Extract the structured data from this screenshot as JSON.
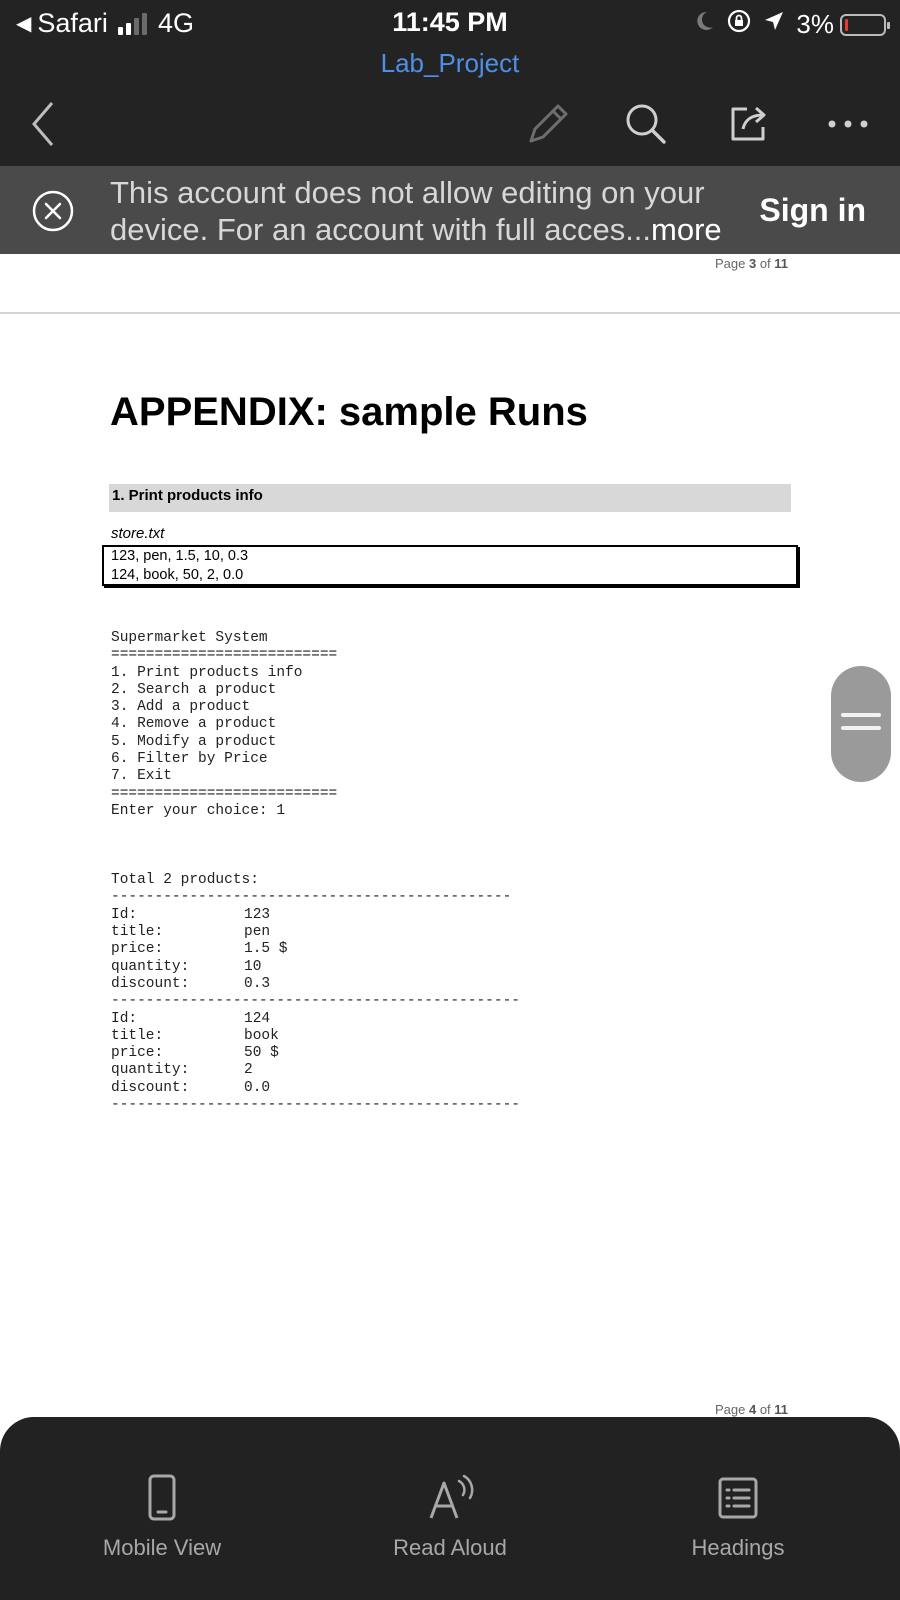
{
  "status_bar": {
    "back_app": "Safari",
    "network": "4G",
    "time": "11:45 PM",
    "battery_percent": "3%",
    "battery_level": 0.03,
    "icons": [
      "moon-icon",
      "rotation-lock-icon",
      "location-arrow-icon"
    ]
  },
  "toolbar": {
    "title": "Lab_Project",
    "icons": [
      "back-chevron-icon",
      "pencil-icon",
      "search-icon",
      "share-icon",
      "more-icon"
    ]
  },
  "banner": {
    "line1": "This account does not allow editing on your",
    "line2": "device. For an account with full acces...",
    "more": "more",
    "sign_in": "Sign in"
  },
  "document": {
    "page_top": {
      "prefix": "Page ",
      "current": "3",
      "of": " of ",
      "total": "11"
    },
    "page_bottom": {
      "prefix": "Page ",
      "current": "4",
      "of": " of ",
      "total": "11"
    },
    "heading": "APPENDIX: sample Runs",
    "section": "1. Print products  info",
    "file_name": "store.txt",
    "file_lines": [
      "123, pen, 1.5, 10, 0.3",
      "124, book, 50, 2, 0.0"
    ],
    "console_menu": [
      "Supermarket System",
      "==========================",
      "1. Print products info",
      "2. Search a product",
      "3. Add a product",
      "4. Remove a product",
      "5. Modify a product",
      "6. Filter by Price",
      "7. Exit",
      "==========================",
      "Enter your choice: 1"
    ],
    "total_line": "Total 2 products:",
    "dash_short": "----------------------------------------------",
    "dash_long": "-----------------------------------------------",
    "products": [
      {
        "id_k": "Id:",
        "id_v": "123",
        "title_k": "title:",
        "title_v": "pen",
        "price_k": "price:",
        "price_v": "1.5 $",
        "qty_k": "quantity:",
        "qty_v": "10",
        "disc_k": "discount:",
        "disc_v": "0.3"
      },
      {
        "id_k": "Id:",
        "id_v": "124",
        "title_k": "title:",
        "title_v": "book",
        "price_k": "price:",
        "price_v": "50 $",
        "qty_k": "quantity:",
        "qty_v": "2",
        "disc_k": "discount:",
        "disc_v": "0.0"
      }
    ]
  },
  "bottom_tabs": [
    {
      "label": "Mobile View",
      "icon": "phone-icon"
    },
    {
      "label": "Read Aloud",
      "icon": "read-aloud-icon"
    },
    {
      "label": "Headings",
      "icon": "headings-list-icon"
    }
  ]
}
